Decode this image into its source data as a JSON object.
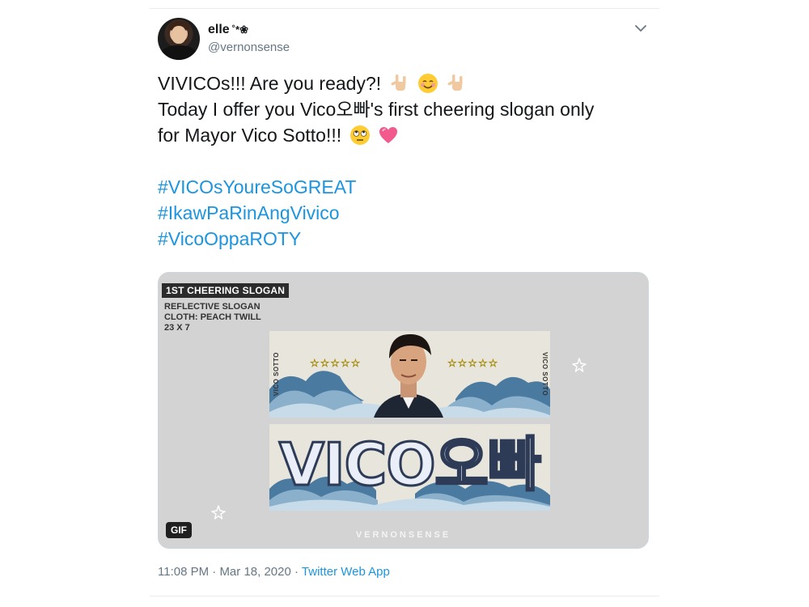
{
  "user": {
    "name": "elle",
    "name_deco": "˚*❀",
    "handle": "@vernonsense"
  },
  "tweet": {
    "line1": "VIVICOs!!! Are you ready?!",
    "line2": "Today I offer you Vico오빠's first cheering slogan only",
    "line3": "for Mayor Vico Sotto!!!",
    "hashtags": [
      "#VICOsYoureSoGREAT",
      "#IkawPaRinAngVivico",
      "#VicoOppaROTY"
    ],
    "emojis_line1": [
      "love-you-gesture-icon",
      "smiling-face-icon",
      "love-you-gesture-icon"
    ],
    "emojis_line3": [
      "rolling-eyes-face-icon",
      "heart-icon"
    ]
  },
  "media": {
    "title": "1ST CHEERING SLOGAN",
    "spec1": "REFLECTIVE SLOGAN",
    "spec2": "CLOTH: PEACH TWILL",
    "spec3": "23 X 7",
    "vertical_label": "VICO SOTTO",
    "stars": "☆☆☆☆☆",
    "big_text": "VICO오빠",
    "gif_badge": "GIF",
    "watermark": "VERNONSENSE"
  },
  "meta": {
    "time": "11:08 PM",
    "separator": "·",
    "date": "Mar 18, 2020",
    "app": "Twitter Web App"
  },
  "colors": {
    "link": "#1b95e0",
    "muted": "#657786",
    "text": "#14171a"
  }
}
